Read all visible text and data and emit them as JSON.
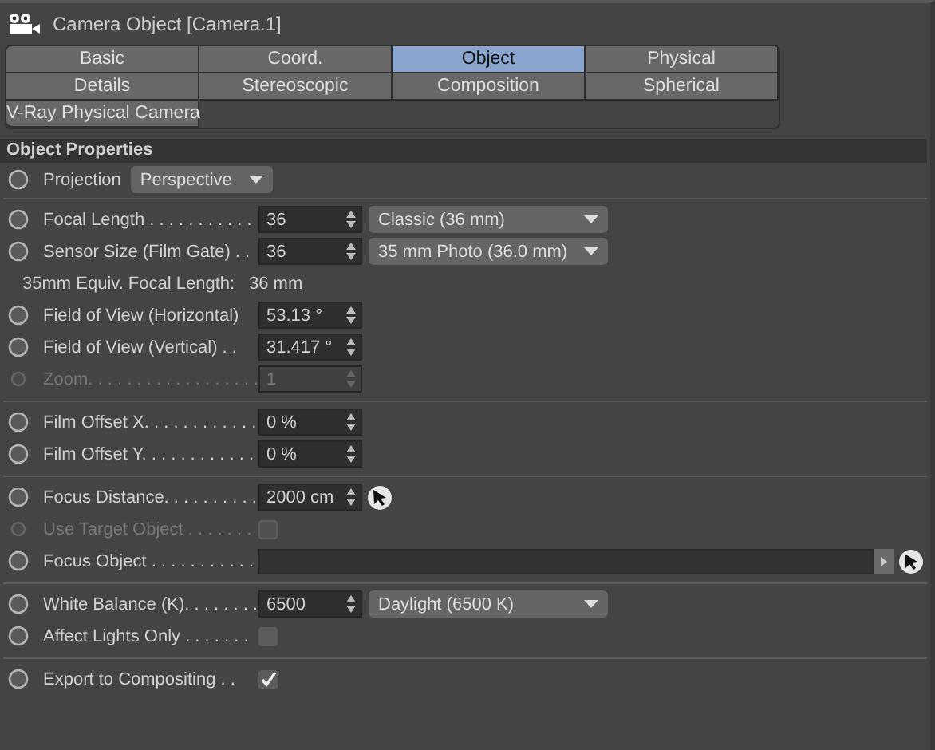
{
  "window": {
    "title": "Camera Object [Camera.1]"
  },
  "tabs": [
    {
      "label": "Basic",
      "selected": false
    },
    {
      "label": "Coord.",
      "selected": false
    },
    {
      "label": "Object",
      "selected": true
    },
    {
      "label": "Physical",
      "selected": false
    },
    {
      "label": "Details",
      "selected": false
    },
    {
      "label": "Stereoscopic",
      "selected": false
    },
    {
      "label": "Composition",
      "selected": false
    },
    {
      "label": "Spherical",
      "selected": false
    },
    {
      "label": "V-Ray Physical Camera",
      "selected": false
    }
  ],
  "section": {
    "title": "Object Properties"
  },
  "projection": {
    "label": "Projection",
    "value": "Perspective"
  },
  "groups": [
    [
      {
        "kind": "number",
        "label": "Focal Length . . . . . . . . . . .",
        "value": "36",
        "preset": "Classic (36 mm)",
        "disabled": false
      },
      {
        "kind": "number",
        "label": "Sensor Size (Film Gate) . .",
        "value": "36",
        "preset": "35 mm Photo (36.0 mm)",
        "disabled": false
      },
      {
        "kind": "info",
        "label": "35mm Equiv. Focal Length:",
        "value": "36 mm"
      },
      {
        "kind": "number",
        "label": "Field of View (Horizontal)",
        "value": "53.13 °",
        "disabled": false
      },
      {
        "kind": "number",
        "label": "Field of View (Vertical) . .",
        "value": "31.417 °",
        "disabled": false
      },
      {
        "kind": "number",
        "label": "Zoom. . . . . . . . . . . . . . . . . .",
        "value": "1",
        "disabled": true
      }
    ],
    [
      {
        "kind": "number",
        "label": "Film Offset X. . . . . . . . . . . .",
        "value": "0 %",
        "disabled": false
      },
      {
        "kind": "number",
        "label": "Film Offset Y. . . . . . . . . . . .",
        "value": "0 %",
        "disabled": false
      }
    ],
    [
      {
        "kind": "number",
        "label": "Focus Distance. . . . . . . . . .",
        "value": "2000 cm",
        "picker": true,
        "disabled": false
      },
      {
        "kind": "checkbox",
        "label": "Use Target Object . . . . . . .",
        "checked": false,
        "disabled": true
      },
      {
        "kind": "link",
        "label": "Focus Object . . . . . . . . . . .",
        "disabled": false
      }
    ],
    [
      {
        "kind": "number",
        "label": "White Balance (K). . . . . . . .",
        "value": "6500",
        "preset": "Daylight (6500 K)",
        "disabled": false
      },
      {
        "kind": "checkbox",
        "label": "Affect Lights Only . . . . . . .",
        "checked": false,
        "disabled": false
      }
    ],
    [
      {
        "kind": "checkbox",
        "label": "Export to Compositing . .",
        "checked": true,
        "disabled": false
      }
    ]
  ]
}
